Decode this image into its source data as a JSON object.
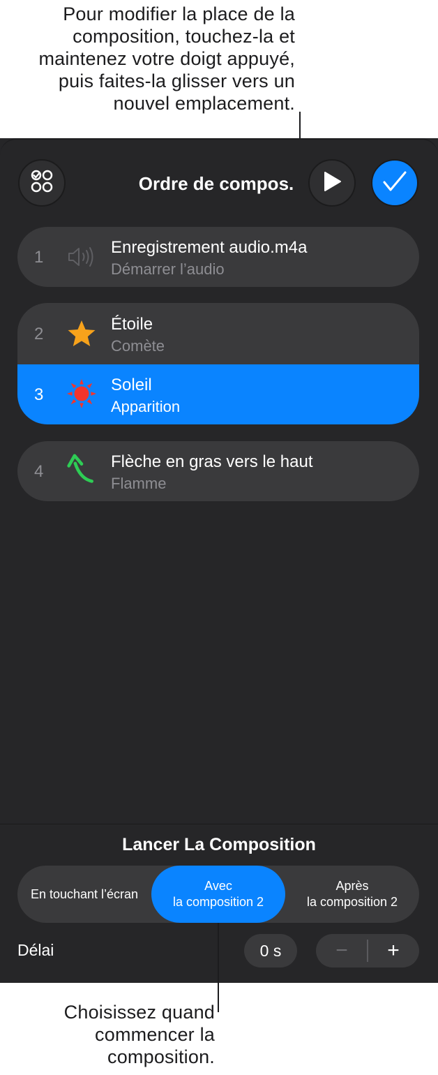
{
  "callouts": {
    "top": "Pour modifier la place de la\ncomposition, touchez-la et\nmaintenez votre doigt appuyé,\npuis faites-la glisser vers un\nnouvel emplacement.",
    "bottom": "Choisissez quand\ncommencer la\ncomposition."
  },
  "header": {
    "title": "Ordre de compos."
  },
  "builds": [
    {
      "number": "1",
      "title": "Enregistrement audio.m4a",
      "subtitle": "Démarrer l’audio",
      "icon": "speaker-icon"
    },
    {
      "number": "2",
      "title": "Étoile",
      "subtitle": "Comète",
      "icon": "star-icon"
    },
    {
      "number": "3",
      "title": "Soleil",
      "subtitle": "Apparition",
      "icon": "sun-icon",
      "selected": true
    },
    {
      "number": "4",
      "title": "Flèche en gras vers le haut",
      "subtitle": "Flamme",
      "icon": "arrow-icon"
    }
  ],
  "start": {
    "title": "Lancer La Composition",
    "options": [
      {
        "line1": "En touchant l’écran",
        "line2": ""
      },
      {
        "line1": "Avec",
        "line2": "la composition 2",
        "active": true
      },
      {
        "line1": "Après",
        "line2": "la composition 2"
      }
    ]
  },
  "delay": {
    "label": "Délai",
    "value": "0 s",
    "minus": "−",
    "plus": "+"
  },
  "colors": {
    "accent": "#0a84ff",
    "panel": "#262628",
    "row": "#3a3a3c",
    "star": "#f7a21b",
    "sun": "#f2352d",
    "arrow": "#2ecc55"
  }
}
